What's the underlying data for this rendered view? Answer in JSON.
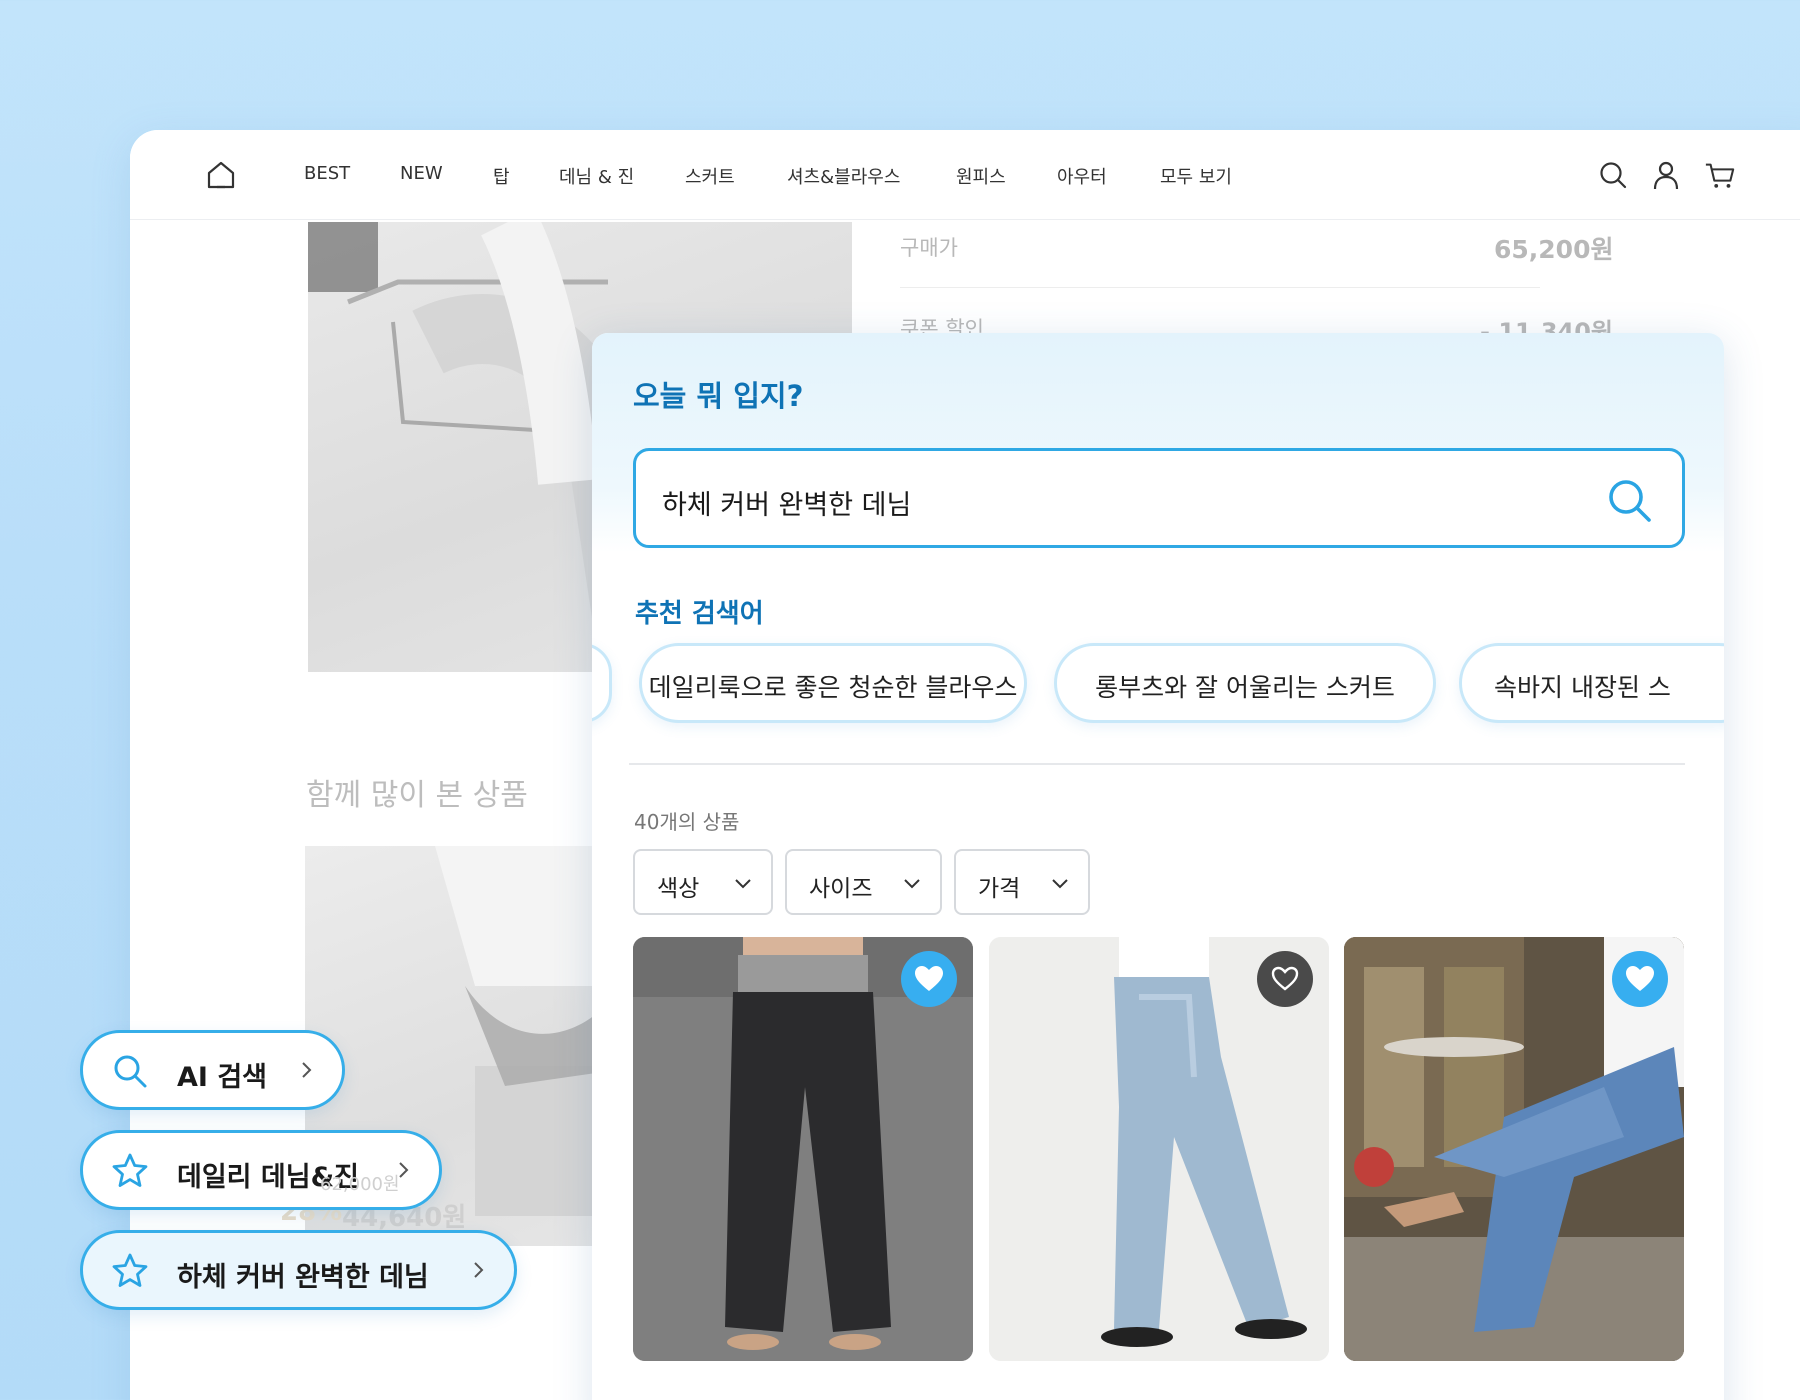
{
  "nav": {
    "items": [
      "BEST",
      "NEW",
      "탑",
      "데님 & 진",
      "스커트",
      "셔츠&블라우스",
      "원피스",
      "아우터",
      "모두 보기"
    ]
  },
  "background_page": {
    "price_label": "구매가",
    "price_value": "65,200원",
    "coupon_label": "쿠폰 할인",
    "coupon_value": "- 11,340원",
    "related_title": "함께 많이 본 상품",
    "orig_price": "62,000원",
    "discount": "28%",
    "sale_price": "44,640원"
  },
  "search_panel": {
    "title": "오늘 뭐 입지?",
    "query": "하체 커버 완벽한 데님",
    "recommend_title": "추천 검색어",
    "chips": [
      "데일리룩으로 좋은 청순한 블라우스",
      "롱부츠와 잘 어울리는 스커트",
      "속바지 내장된 스"
    ],
    "result_count": "40개의 상품",
    "filters": [
      "색상",
      "사이즈",
      "가격"
    ],
    "products": [
      {
        "name": "black-wide-pants",
        "liked": true
      },
      {
        "name": "light-wash-wide-jeans",
        "liked": false
      },
      {
        "name": "wide-leg-jeans-cafe",
        "liked": true
      }
    ]
  },
  "shortcuts": [
    {
      "label": "AI 검색",
      "icon": "search-icon"
    },
    {
      "label": "데일리 데님&진",
      "icon": "star-icon"
    },
    {
      "label": "하체 커버 완벽한 데님",
      "icon": "star-icon"
    }
  ],
  "colors": {
    "accent": "#2fa8e4",
    "title_blue": "#0f73b5",
    "heart_active": "#37aef0",
    "heart_inactive": "#4a4a4a"
  }
}
